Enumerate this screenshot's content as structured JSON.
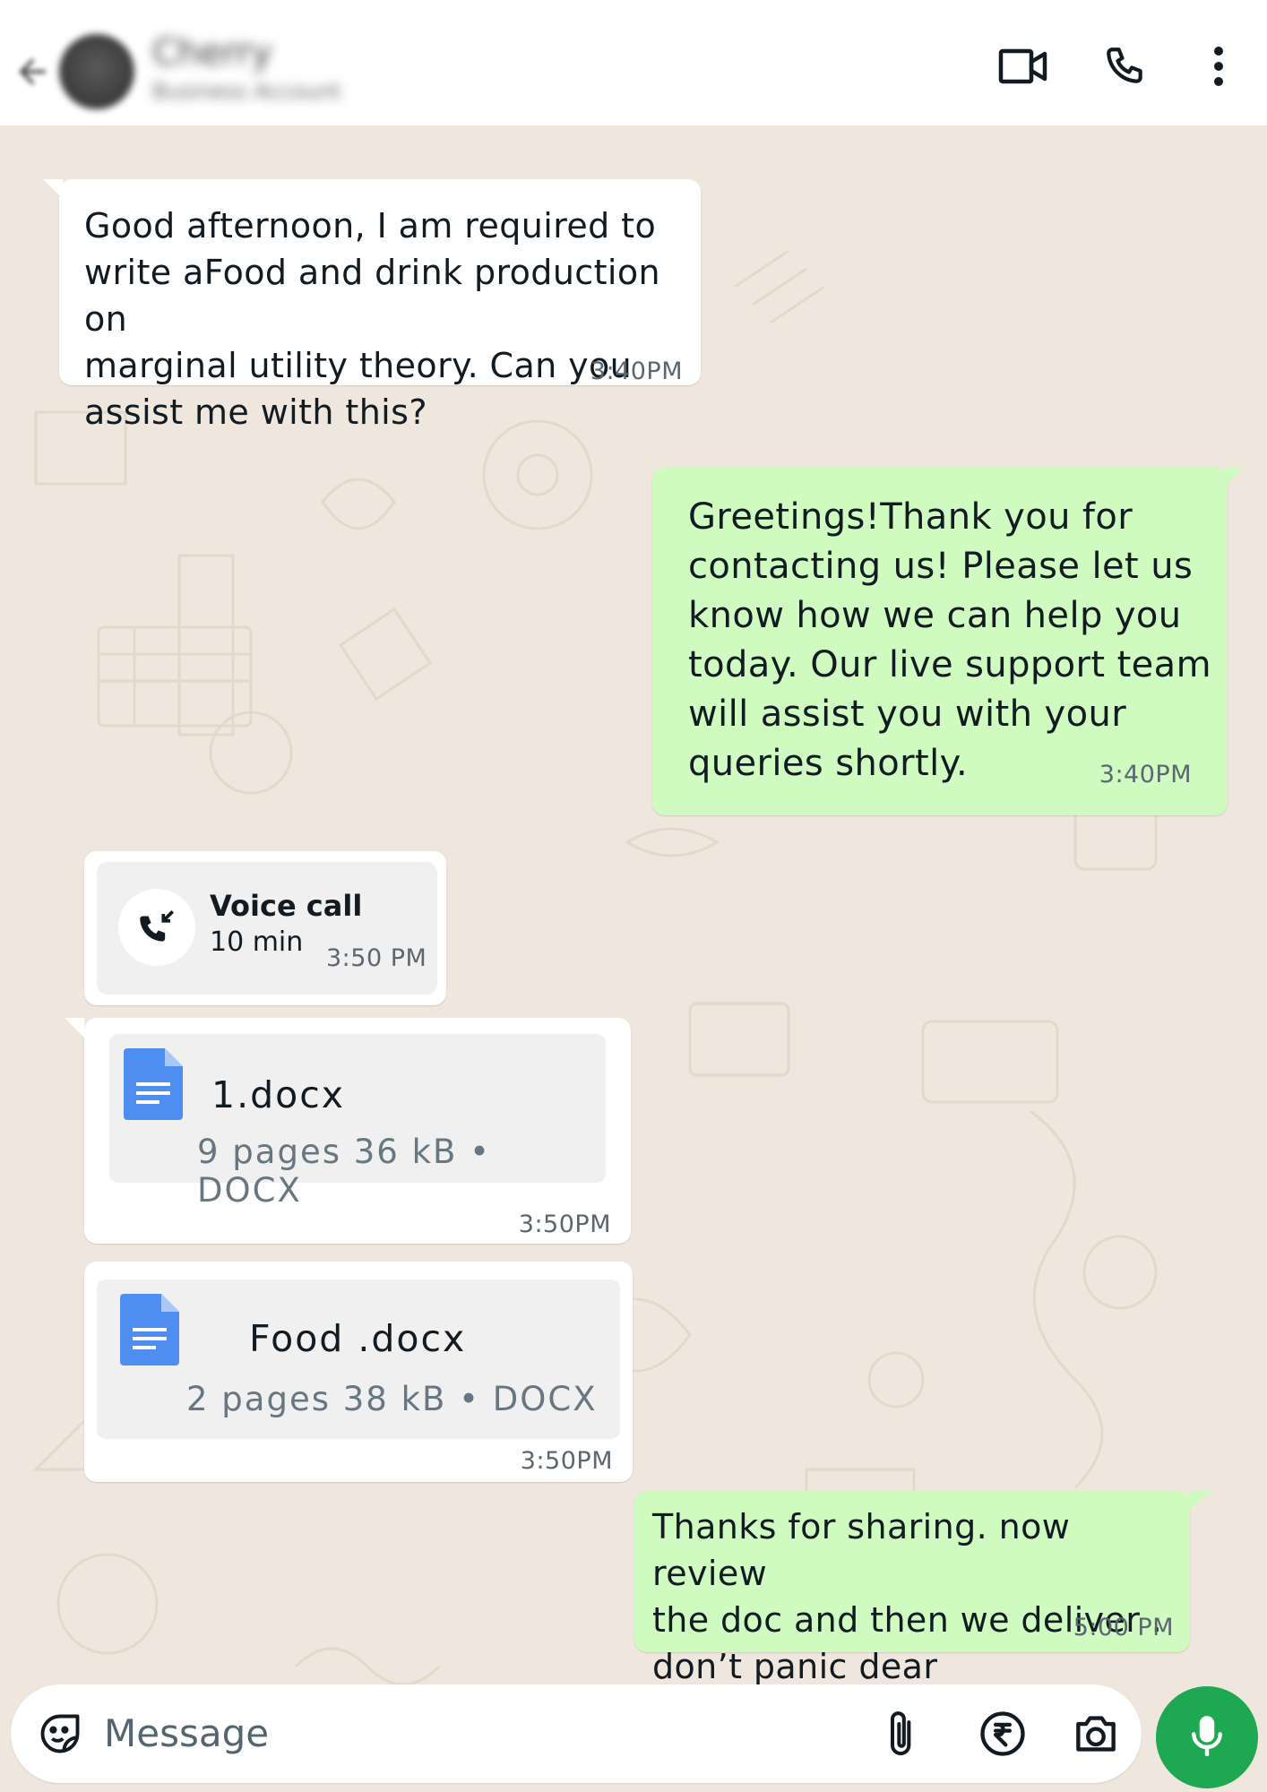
{
  "header": {
    "contact_name": "Cherry",
    "contact_subtitle": "Business Account"
  },
  "messages": [
    {
      "type": "text",
      "direction": "incoming",
      "text": "Good afternoon, I am required to\nwrite aFood and drink production on\nmarginal utility theory. Can you\nassist me with this?",
      "time": "3:40PM"
    },
    {
      "type": "text",
      "direction": "outgoing",
      "text": "Greetings!Thank you for\ncontacting us! Please let us\nknow how we can help you\ntoday. Our live support team\nwill assist you with your\nqueries shortly.",
      "time": "3:40PM"
    },
    {
      "type": "call",
      "direction": "incoming",
      "title": "Voice call",
      "duration": "10 min",
      "time": "3:50 PM"
    },
    {
      "type": "document",
      "direction": "incoming",
      "name": "1.docx",
      "meta": "9 pages 36 kB • DOCX",
      "time": "3:50PM"
    },
    {
      "type": "document",
      "direction": "incoming",
      "name": "Food .docx",
      "meta": "2 pages 38 kB • DOCX",
      "time": "3:50PM"
    },
    {
      "type": "text",
      "direction": "outgoing",
      "text": "Thanks for sharing. now review\nthe doc and then we deliver .\ndon’t panic dear",
      "time": "5:00 PM"
    }
  ],
  "composer": {
    "placeholder": "Message"
  },
  "colors": {
    "incoming_bubble": "#ffffff",
    "outgoing_bubble": "#d0fbc0",
    "mic_button": "#1da851",
    "chat_background": "#efe7dd"
  },
  "icons": {
    "header": [
      "back-arrow-icon",
      "video-call-icon",
      "phone-icon",
      "more-options-icon"
    ],
    "composer": [
      "emoji-sticker-icon",
      "attach-icon",
      "rupee-payment-icon",
      "camera-icon",
      "mic-icon"
    ],
    "call": "incoming-call-icon",
    "document": "document-icon"
  }
}
